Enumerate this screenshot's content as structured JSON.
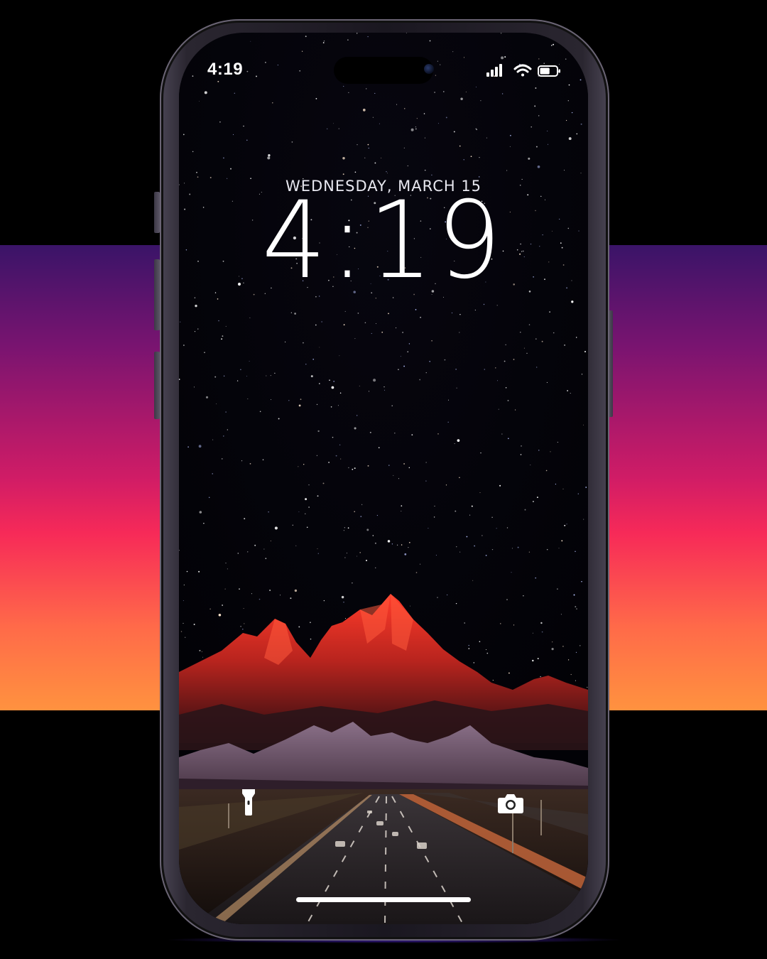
{
  "lockscreen": {
    "status_time": "4:19",
    "date": "WEDNESDAY, MARCH 15",
    "clock": "4:19",
    "battery_level": 0.6
  },
  "quick_actions": {
    "flashlight_icon": "flashlight-icon",
    "camera_icon": "camera-icon"
  },
  "colors": {
    "band_top": "#3a1468",
    "band_mid": "#f72a58",
    "band_bottom": "#ff923f",
    "mountain_highlight": "#e0332a",
    "sky": "#020206"
  }
}
